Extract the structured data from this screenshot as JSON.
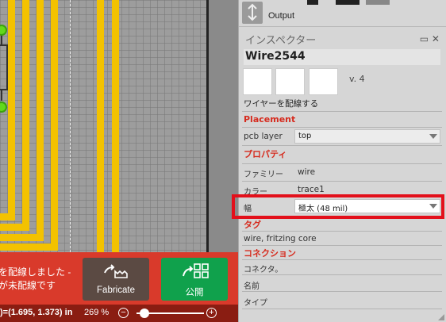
{
  "canvas": {
    "colors": {
      "trace": "#f3c200",
      "pad": "#62d81c",
      "board_edge": "#232323"
    }
  },
  "bottom_bar": {
    "status_line1": "を配線しました -",
    "status_line2": "が未配線です",
    "fabricate_label": "Fabricate",
    "share_label": "公開",
    "colors": {
      "bar": "#d93a2b",
      "fabricate": "#5b4a43",
      "share": "#10a14c"
    }
  },
  "status_bar": {
    "coords": ")=(1.695, 1.373) in",
    "zoom_text": "269 %",
    "zoom_out": "−",
    "zoom_in": "+",
    "zoom_slider_level": 0.12
  },
  "output_panel": {
    "label": "Output"
  },
  "inspector": {
    "title": "インスペクター",
    "window_icons": "▭ ✕",
    "part_title": "Wire2544",
    "version": "v. 4",
    "description": "ワイヤーを配線する",
    "placement": {
      "heading": "Placement",
      "pcb_layer_label": "pcb layer",
      "pcb_layer_value": "top"
    },
    "properties": {
      "heading": "プロパティ",
      "family_label": "ファミリー",
      "family_value": "wire",
      "color_label": "カラー",
      "color_value": "trace1",
      "width_label": "幅",
      "width_value": "極太 (48 mil)"
    },
    "tags": {
      "heading": "タグ",
      "value": "wire, fritzing core"
    },
    "connections": {
      "heading": "コネクション",
      "connector_label": "コネクタ。",
      "name_label": "名前",
      "type_label": "タイプ"
    },
    "colors": {
      "section_heading": "#d62b1e",
      "highlight": "#e3101b"
    }
  }
}
